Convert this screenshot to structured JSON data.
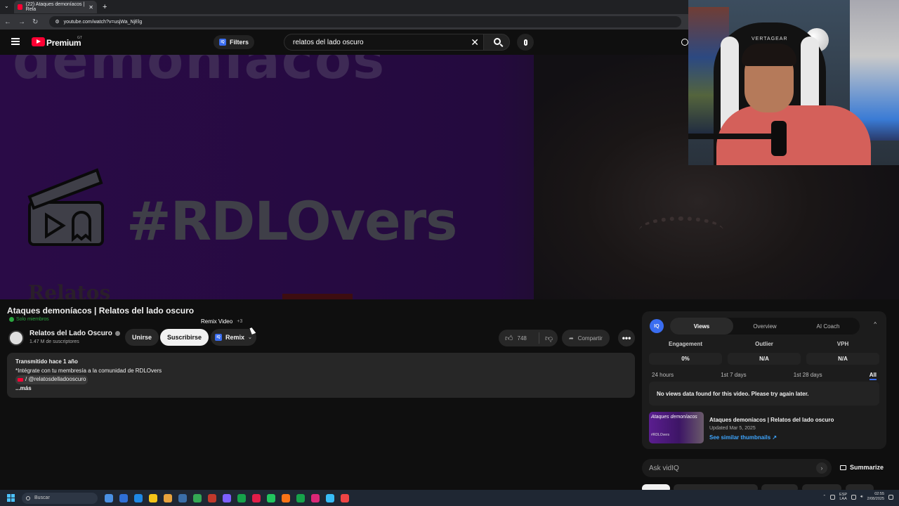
{
  "browser": {
    "tab_title": "(22) Ataques demoníacos | Rela",
    "url": "youtube.com/watch?v=usjWa_NjElg"
  },
  "youtube": {
    "brand": "Premium",
    "country": "GT",
    "filters_label": "Filters",
    "iq_badge": "IQ",
    "search_value": "relatos del lado oscuro"
  },
  "video_frame": {
    "top_text": "demoníacos",
    "hashtag": "#RDLOvers",
    "bottom_text": "Relatos"
  },
  "webcam": {
    "chair_brand": "VERTAGEAR"
  },
  "video": {
    "title": "Ataques demoníacos | Relatos del lado oscuro",
    "members_label": "Solo miembros",
    "channel_name": "Relatos del Lado Oscuro",
    "subscribers": "1.47 M de suscriptores",
    "join_label": "Unirse",
    "subscribe_label": "Suscribirse",
    "remix_label": "Remix",
    "remix_tooltip": "Remix Video",
    "remix_tooltip_count": "3",
    "likes": "748",
    "share_label": "Compartir",
    "more_label": "•••"
  },
  "description": {
    "line1": "Transmitido hace 1 año",
    "line2": "*Intégrate con tu membresía a la comunidad de RDLOvers",
    "handle": "/ @relatosdelladooscuro",
    "more": "...más"
  },
  "vidiq": {
    "logo": "IQ",
    "tabs": [
      "Views",
      "Overview",
      "AI Coach"
    ],
    "active_tab": "Views",
    "collapse_icon": "^",
    "metrics": [
      {
        "label": "Engagement",
        "value": "0%"
      },
      {
        "label": "Outlier",
        "value": "N/A"
      },
      {
        "label": "VPH",
        "value": "N/A"
      }
    ],
    "periods": [
      "24 hours",
      "1st 7 days",
      "1st 28 days",
      "All"
    ],
    "active_period": "All",
    "empty_message": "No views data found for this video. Please try again later.",
    "thumb_text": "Ataques demoníacos",
    "thumb_tag": "#RDLOvers",
    "card_title": "Ataques demoníacos | Relatos del lado oscuro",
    "card_date": "Updated Mar 5, 2025",
    "card_link": "See similar thumbnails ↗"
  },
  "ask": {
    "placeholder": "Ask vidIQ",
    "arrow": "›",
    "summarize_label": "Summarize"
  },
  "taskbar": {
    "search_placeholder": "Buscar",
    "lang_line1": "ESP",
    "lang_line2": "LAA",
    "time": "02:55",
    "date": "2/08/2025",
    "app_colors": [
      "#4a90e2",
      "#2f6fd6",
      "#1e88e5",
      "#f5c518",
      "#e8a33d",
      "#3b6ea8",
      "#34a853",
      "#c0392b",
      "#7d5fff",
      "#16a34a",
      "#e11d48",
      "#22c55e",
      "#f97316",
      "#16a34a",
      "#db2777",
      "#38bdf8",
      "#ef4444"
    ]
  }
}
